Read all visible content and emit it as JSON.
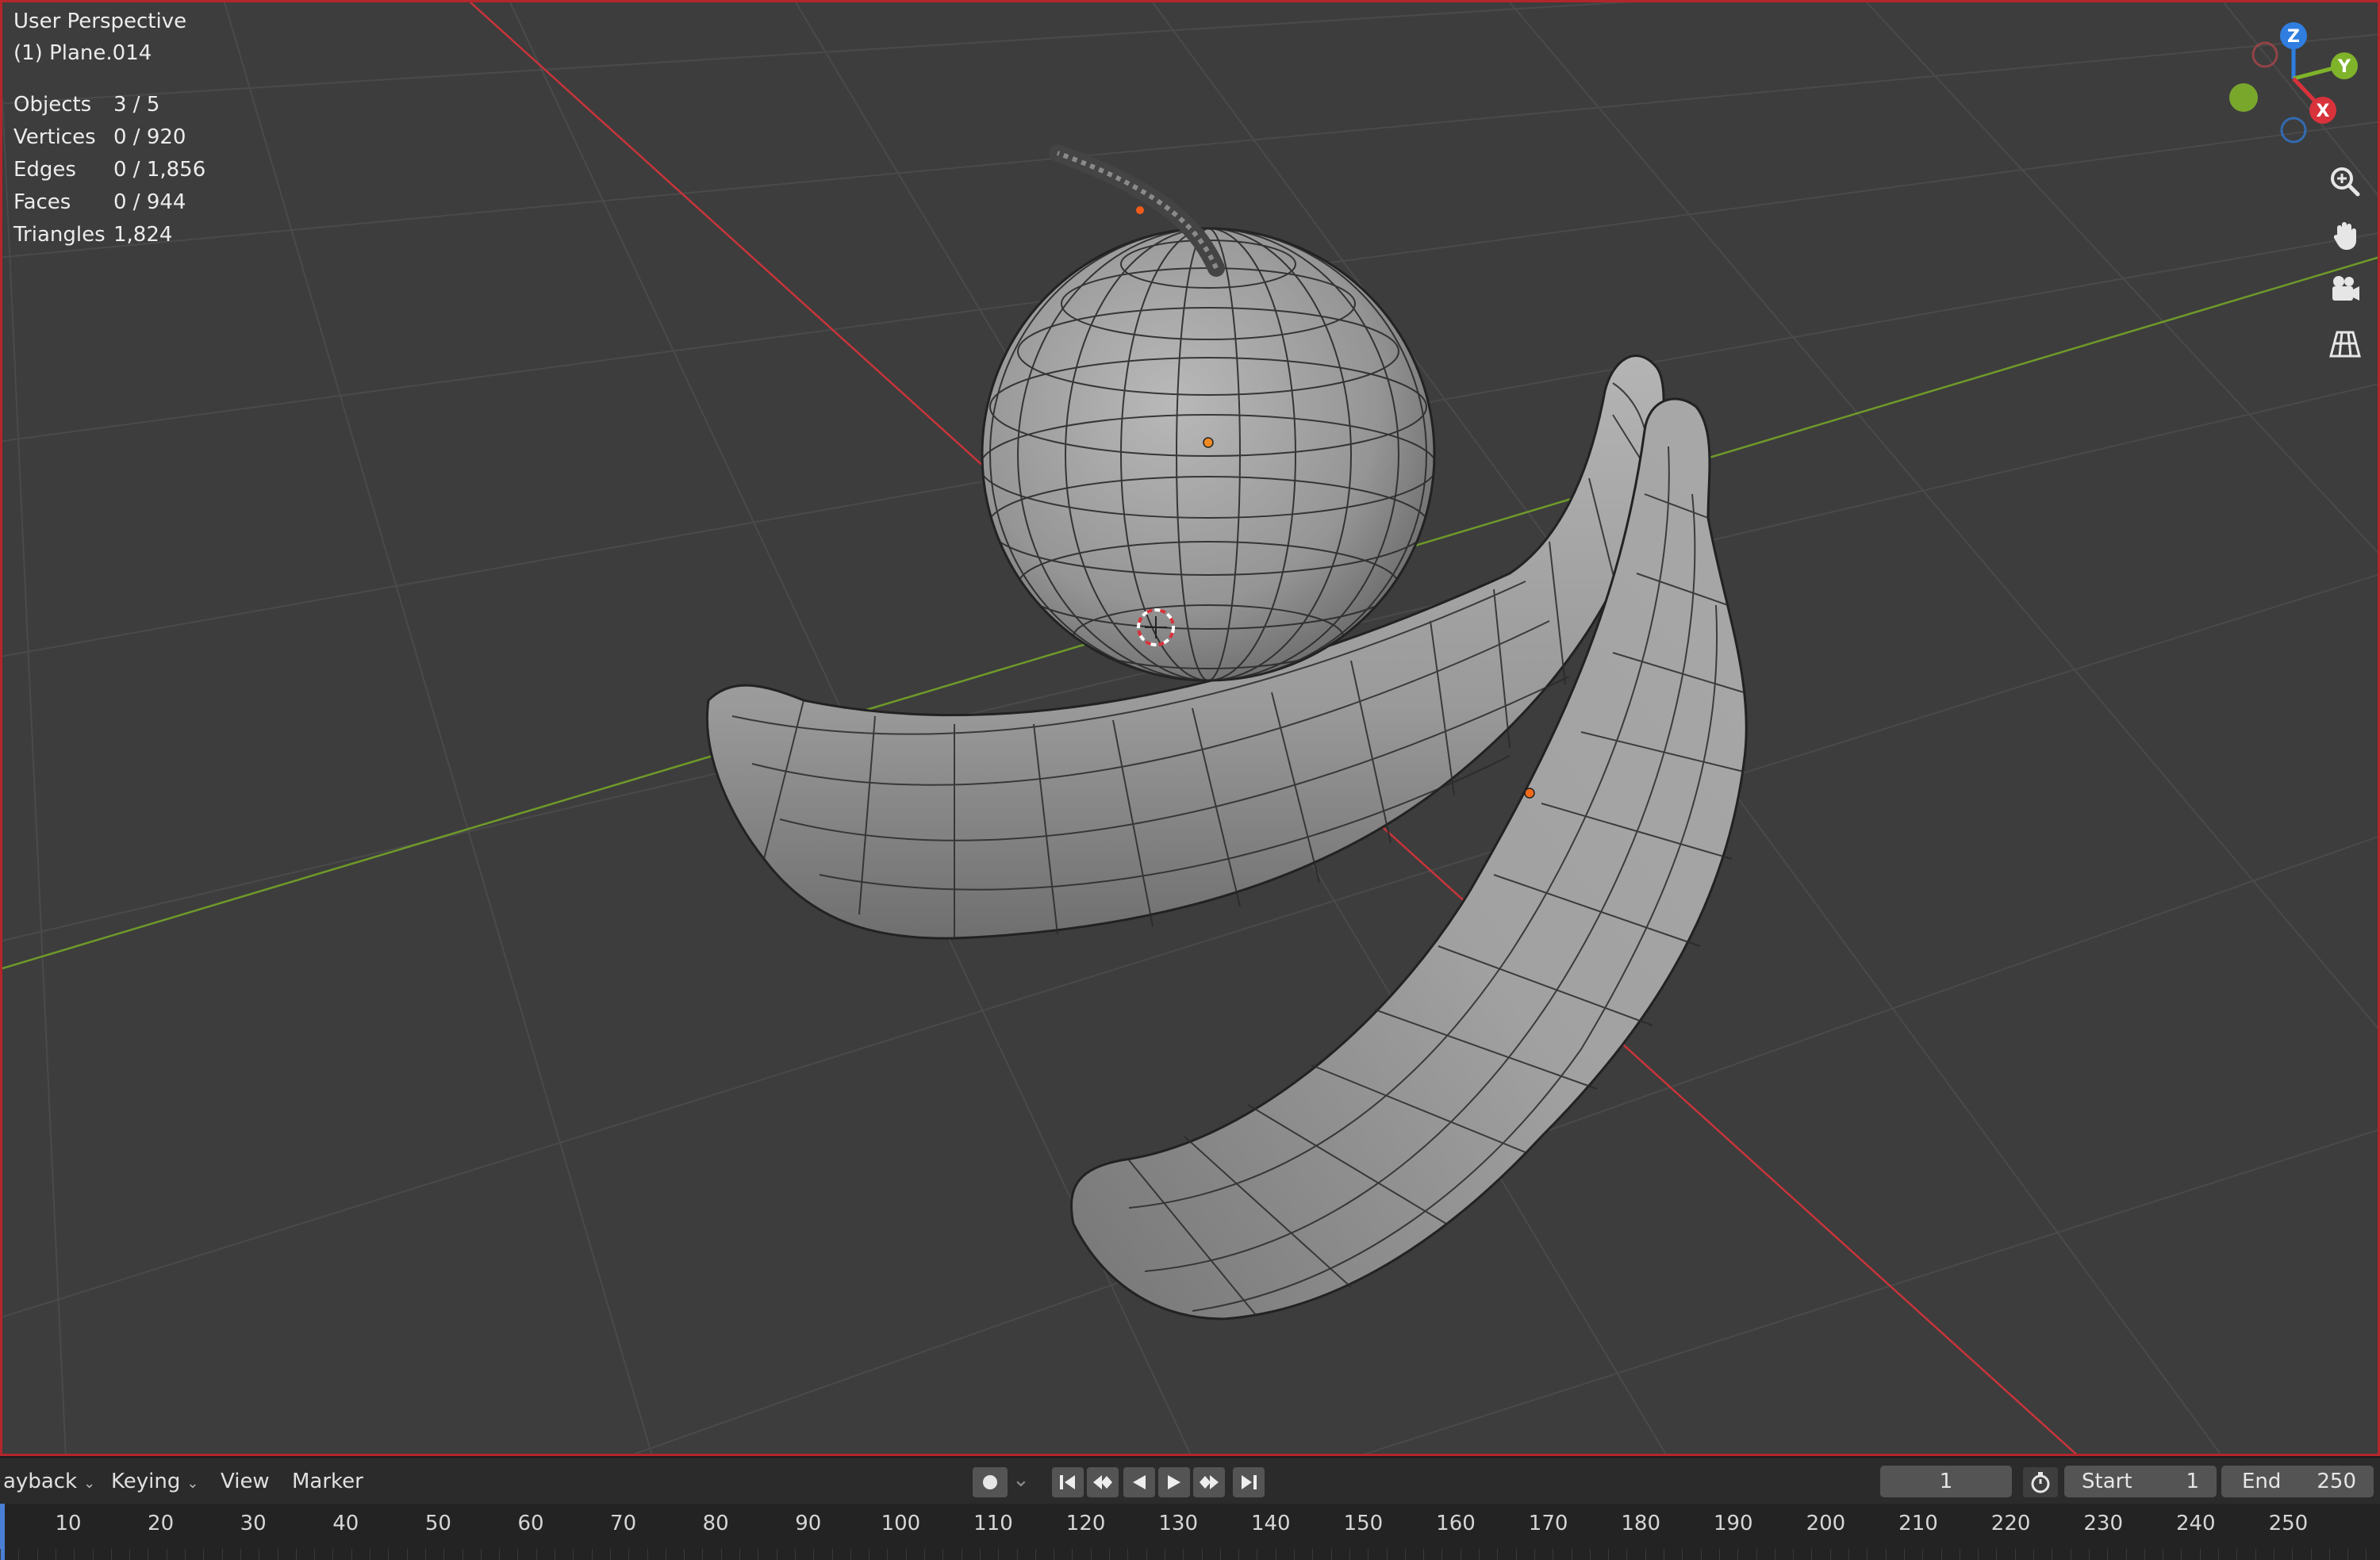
{
  "viewport": {
    "view_name": "User Perspective",
    "active_object": "(1) Plane.014",
    "stats": [
      {
        "label": "Objects",
        "value": "3 / 5"
      },
      {
        "label": "Vertices",
        "value": "0 / 920"
      },
      {
        "label": "Edges",
        "value": "0 / 1,856"
      },
      {
        "label": "Faces",
        "value": "0 / 944"
      },
      {
        "label": "Triangles",
        "value": "1,824"
      }
    ],
    "gizmo": {
      "z": "Z",
      "y": "Y",
      "x": "X"
    },
    "nav_icons": [
      "zoom-icon",
      "pan-hand-icon",
      "camera-icon",
      "grid-perspective-icon"
    ],
    "colors": {
      "background": "#3d3d3d",
      "x_axis": "#d8323b",
      "y_axis": "#7fb32a",
      "z_axis": "#2f7ee0",
      "mesh": "#9c9c9c"
    }
  },
  "timeline": {
    "menus": [
      {
        "label": "ayback",
        "dropdown": true
      },
      {
        "label": "Keying",
        "dropdown": true
      },
      {
        "label": "View",
        "dropdown": false
      },
      {
        "label": "Marker",
        "dropdown": false
      }
    ],
    "current_frame": "1",
    "start_label": "Start",
    "start_value": "1",
    "end_label": "End",
    "end_value": "250",
    "ruler_ticks": [
      "10",
      "20",
      "30",
      "40",
      "50",
      "60",
      "70",
      "80",
      "90",
      "100",
      "110",
      "120",
      "130",
      "140",
      "150",
      "160",
      "170",
      "180",
      "190",
      "200",
      "210",
      "220",
      "230",
      "240",
      "250"
    ]
  }
}
